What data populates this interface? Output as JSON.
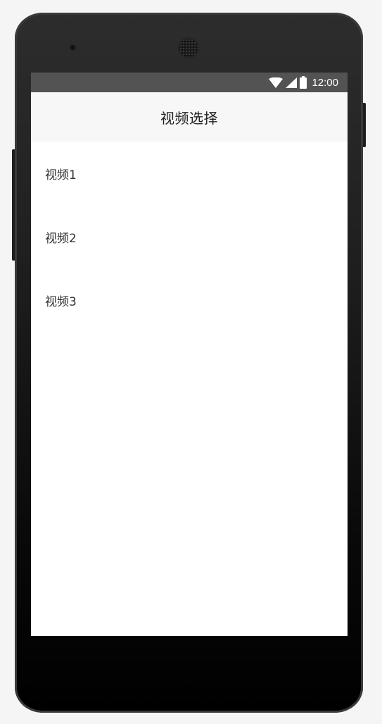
{
  "status_bar": {
    "time": "12:00",
    "icons": [
      "wifi-icon",
      "cellular-signal-icon",
      "battery-icon"
    ],
    "background": "#535353"
  },
  "app_bar": {
    "title": "视频选择",
    "background": "#f7f7f7"
  },
  "video_list": {
    "items": [
      {
        "label": "视频1"
      },
      {
        "label": "视频2"
      },
      {
        "label": "视频3"
      }
    ]
  }
}
